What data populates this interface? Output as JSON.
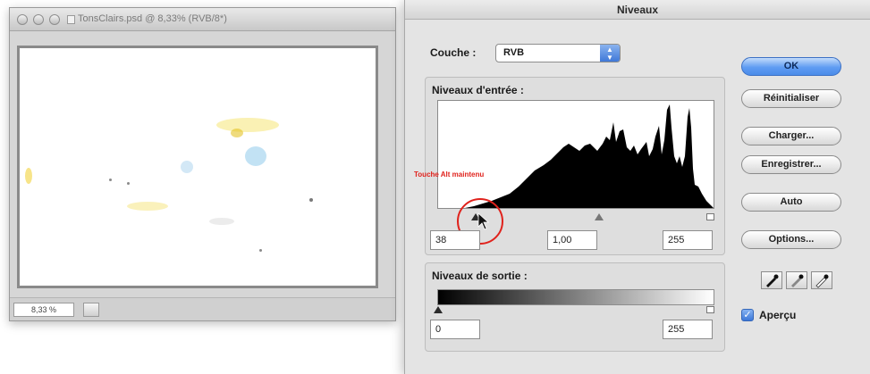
{
  "document_window": {
    "title": "TonsClairs.psd @ 8,33% (RVB/8*)",
    "zoom": "8,33 %"
  },
  "levels_dialog": {
    "title": "Niveaux",
    "channel_label": "Couche :",
    "channel_value": "RVB",
    "input_levels_label": "Niveaux d'entrée :",
    "input_black": "38",
    "input_gamma": "1,00",
    "input_white": "255",
    "output_levels_label": "Niveaux de sortie :",
    "output_black": "0",
    "output_white": "255",
    "annotation": "Touche Alt maintenu",
    "buttons": {
      "ok": "OK",
      "reset": "Réinitialiser",
      "load": "Charger...",
      "save": "Enregistrer...",
      "auto": "Auto",
      "options": "Options..."
    },
    "preview_label": "Aperçu",
    "preview_checked": true,
    "accent_color": "#4b8ce9",
    "annotation_color": "#e0221c"
  }
}
